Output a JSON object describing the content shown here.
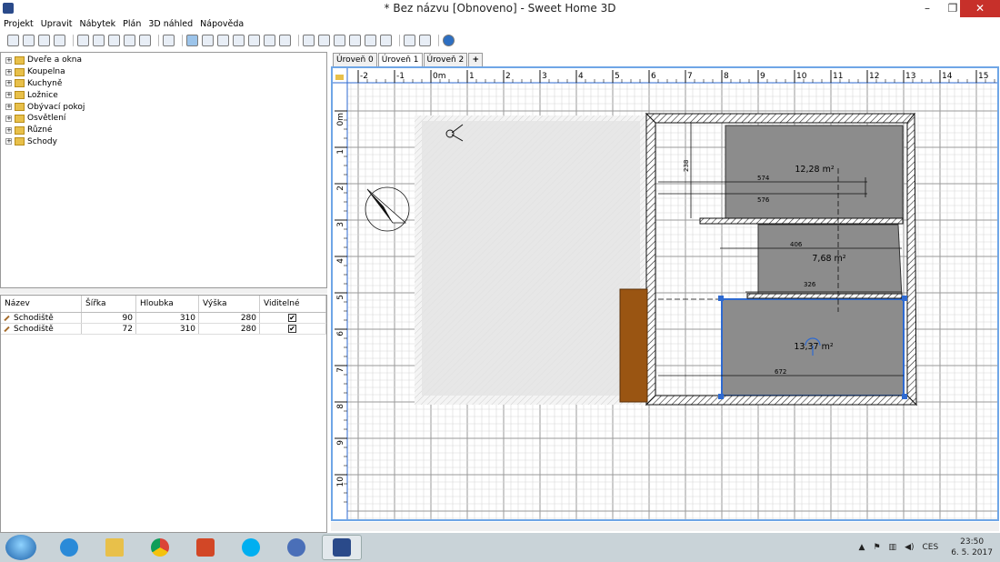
{
  "window": {
    "title": "* Bez názvu [Obnoveno] - Sweet Home 3D",
    "minimize": "–",
    "restore": "❐",
    "close": "✕"
  },
  "menu": [
    "Projekt",
    "Upravit",
    "Nábytek",
    "Plán",
    "3D náhled",
    "Nápověda"
  ],
  "catalog": {
    "items": [
      "Dveře a okna",
      "Koupelna",
      "Kuchyně",
      "Ložnice",
      "Obývací pokoj",
      "Osvětlení",
      "Různé",
      "Schody"
    ]
  },
  "furniture_table": {
    "headers": [
      "Název",
      "Šířka",
      "Hloubka",
      "Výška",
      "Viditelné"
    ],
    "rows": [
      {
        "name": "Schodiště",
        "width": "90",
        "depth": "310",
        "height": "280",
        "visible": "✔"
      },
      {
        "name": "Schodiště",
        "width": "72",
        "depth": "310",
        "height": "280",
        "visible": "✔"
      }
    ]
  },
  "levels": {
    "tabs": [
      "Úroveň 0",
      "Úroveň 1",
      "Úroveň 2"
    ],
    "active": "Úroveň 1",
    "add": "+"
  },
  "plan": {
    "h_ruler": [
      "-2",
      "-1",
      "0m",
      "1",
      "2",
      "3",
      "4",
      "5",
      "6",
      "7",
      "8",
      "9",
      "10",
      "11",
      "12",
      "13",
      "14",
      "15"
    ],
    "v_ruler": [
      "0m",
      "1",
      "2",
      "3",
      "4",
      "5",
      "6",
      "7",
      "8",
      "9",
      "10"
    ],
    "rooms": [
      {
        "area": "12,28 m²"
      },
      {
        "area": "7,68 m²"
      },
      {
        "area": "13,37 m²"
      }
    ],
    "dimensions": [
      "238",
      "574",
      "576",
      "406",
      "326",
      "672"
    ],
    "colors": {
      "grid_minor": "#d8d8d8",
      "grid_major": "#9a9a9a",
      "room": "#8c8c8c",
      "stairs": "#9a5512",
      "selection": "#2e6ad1"
    }
  },
  "taskbar": {
    "apps": [
      "ie-icon",
      "explorer-icon",
      "chrome-icon",
      "office-icon",
      "skype-icon",
      "app-icon",
      "sweethome-icon"
    ],
    "language": "CES",
    "time": "23:50",
    "date": "6. 5. 2017"
  }
}
